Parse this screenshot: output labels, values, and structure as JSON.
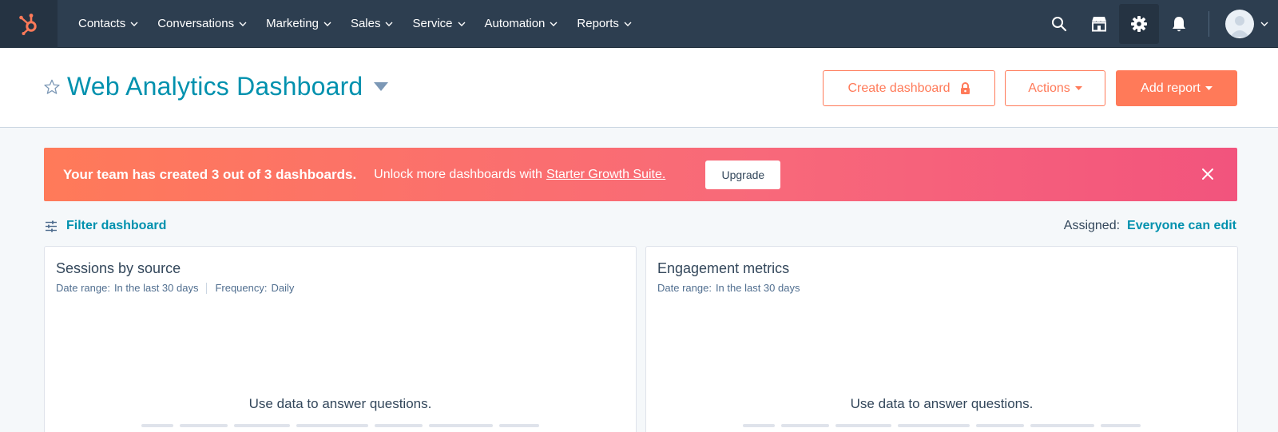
{
  "nav": {
    "items": [
      {
        "label": "Contacts"
      },
      {
        "label": "Conversations"
      },
      {
        "label": "Marketing"
      },
      {
        "label": "Sales"
      },
      {
        "label": "Service"
      },
      {
        "label": "Automation"
      },
      {
        "label": "Reports"
      }
    ],
    "icons": [
      "search-icon",
      "marketplace-icon",
      "settings-icon",
      "notifications-icon"
    ],
    "brand_color": "#ff7a59",
    "bg_color": "#2d3e50"
  },
  "header": {
    "title": "Web Analytics Dashboard",
    "create_dashboard_label": "Create dashboard",
    "actions_label": "Actions",
    "add_report_label": "Add report"
  },
  "banner": {
    "strong_text": "Your team has created 3 out of 3 dashboards.",
    "text": "Unlock more dashboards with",
    "link_text": "Starter Growth Suite.",
    "upgrade_label": "Upgrade"
  },
  "filter": {
    "label": "Filter dashboard",
    "assigned_label": "Assigned:",
    "assigned_value": "Everyone can edit"
  },
  "cards": [
    {
      "title": "Sessions by source",
      "date_range_label": "Date range:",
      "date_range_value": "In the last 30 days",
      "frequency_label": "Frequency:",
      "frequency_value": "Daily",
      "empty_title": "Use data to answer questions."
    },
    {
      "title": "Engagement metrics",
      "date_range_label": "Date range:",
      "date_range_value": "In the last 30 days",
      "empty_title": "Use data to answer questions."
    }
  ]
}
